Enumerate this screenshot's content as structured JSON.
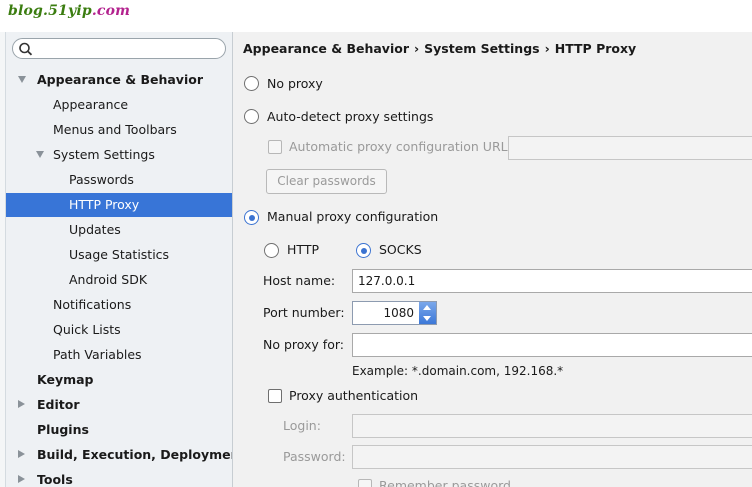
{
  "watermark": {
    "prefix": "blog.51yip",
    "tld": ".com"
  },
  "search": {
    "value": "",
    "placeholder": "",
    "icon": "search-icon"
  },
  "sidebar": {
    "selected_color": "#3875d7",
    "items": [
      {
        "id": "appearance-behavior",
        "label": "Appearance & Behavior",
        "level": 0,
        "bold": true,
        "caret": "down"
      },
      {
        "id": "appearance",
        "label": "Appearance",
        "level": 1
      },
      {
        "id": "menus-toolbars",
        "label": "Menus and Toolbars",
        "level": 1
      },
      {
        "id": "system-settings",
        "label": "System Settings",
        "level": 1,
        "caret": "down"
      },
      {
        "id": "passwords",
        "label": "Passwords",
        "level": 2
      },
      {
        "id": "http-proxy",
        "label": "HTTP Proxy",
        "level": 2,
        "selected": true
      },
      {
        "id": "updates",
        "label": "Updates",
        "level": 2
      },
      {
        "id": "usage-statistics",
        "label": "Usage Statistics",
        "level": 2
      },
      {
        "id": "android-sdk",
        "label": "Android SDK",
        "level": 2
      },
      {
        "id": "notifications",
        "label": "Notifications",
        "level": 1
      },
      {
        "id": "quick-lists",
        "label": "Quick Lists",
        "level": 1
      },
      {
        "id": "path-variables",
        "label": "Path Variables",
        "level": 1
      },
      {
        "id": "keymap",
        "label": "Keymap",
        "level": 0,
        "bold": true
      },
      {
        "id": "editor",
        "label": "Editor",
        "level": 0,
        "bold": true,
        "caret": "right"
      },
      {
        "id": "plugins",
        "label": "Plugins",
        "level": 0,
        "bold": true
      },
      {
        "id": "build-execution-deployment",
        "label": "Build, Execution, Deployment",
        "level": 0,
        "bold": true,
        "caret": "right"
      },
      {
        "id": "tools",
        "label": "Tools",
        "level": 0,
        "bold": true,
        "caret": "right"
      }
    ]
  },
  "breadcrumb": [
    "Appearance & Behavior",
    "System Settings",
    "HTTP Proxy"
  ],
  "breadcrumb_separator": "›",
  "proxy": {
    "no_proxy_label": "No proxy",
    "auto_detect_label": "Auto-detect proxy settings",
    "auto_config_url_label": "Automatic proxy configuration URL:",
    "auto_config_url_value": "",
    "clear_passwords_label": "Clear passwords",
    "manual_label": "Manual proxy configuration",
    "http_label": "HTTP",
    "socks_label": "SOCKS",
    "host_label": "Host name:",
    "host_value": "127.0.0.1",
    "port_label": "Port number:",
    "port_value": "1080",
    "no_proxy_for_label": "No proxy for:",
    "no_proxy_for_value": "",
    "example_text": "Example: *.domain.com, 192.168.*",
    "auth_label": "Proxy authentication",
    "login_label": "Login:",
    "login_value": "",
    "password_label": "Password:",
    "password_value": "",
    "remember_label": "Remember password",
    "selected_mode": "manual",
    "selected_type": "socks",
    "accent_color": "#3b73d1"
  }
}
